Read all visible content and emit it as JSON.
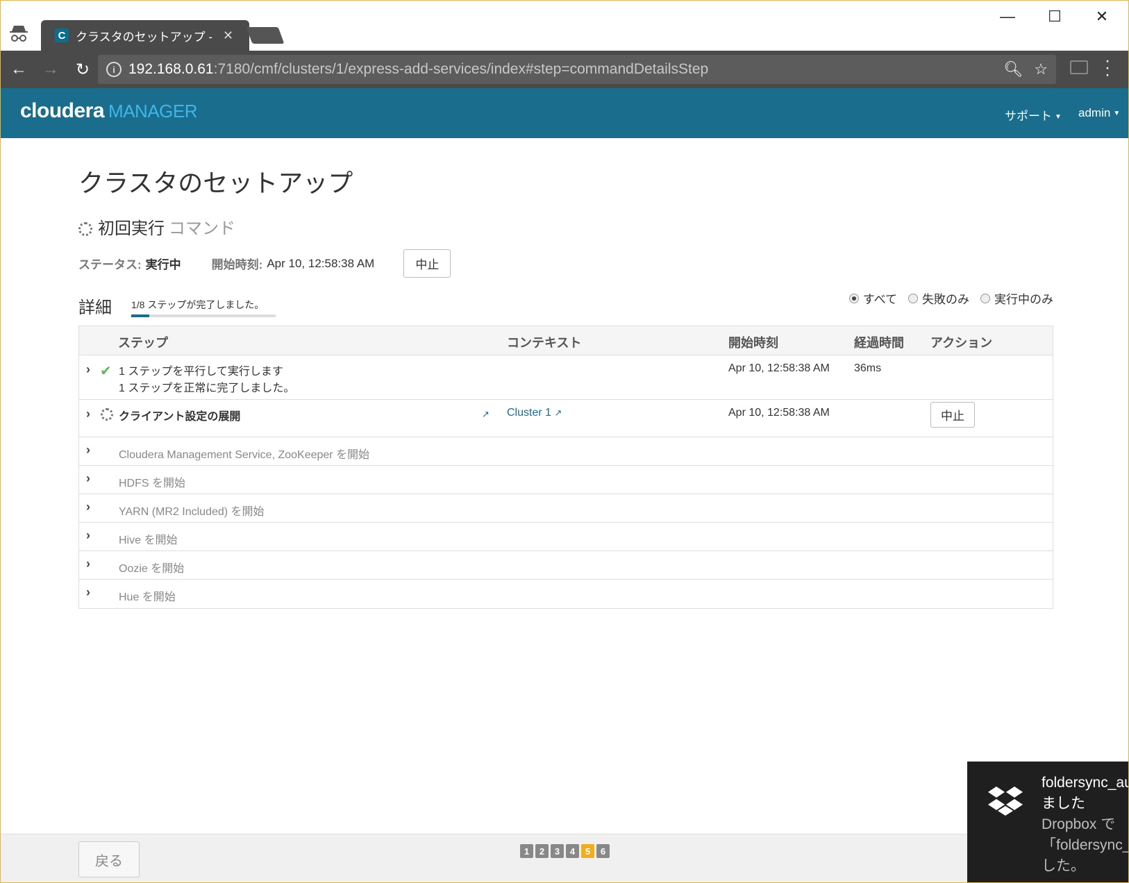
{
  "browser": {
    "tab_title": "クラスタのセットアップ - Clou",
    "url_host": "192.168.0.61",
    "url_rest": ":7180/cmf/clusters/1/express-add-services/index#step=commandDetailsStep"
  },
  "header": {
    "logo_main": "cloudera",
    "logo_sub": "MANAGER",
    "menu_support": "サポート",
    "menu_user": "admin"
  },
  "page": {
    "title": "クラスタのセットアップ",
    "subtitle_main": "初回実行",
    "subtitle_muted": "コマンド",
    "status_label": "ステータス:",
    "status_value": "実行中",
    "start_label": "開始時刻:",
    "start_value": "Apr 10, 12:58:38 AM",
    "abort_button": "中止",
    "details_title": "詳細",
    "progress_text": "1/8 ステップが完了しました。",
    "progress_fraction": 0.125,
    "filters": [
      "すべて",
      "失敗のみ",
      "実行中のみ"
    ]
  },
  "table": {
    "headers": {
      "step": "ステップ",
      "context": "コンテキスト",
      "start": "開始時刻",
      "elapsed": "経過時間",
      "action": "アクション"
    },
    "row1": {
      "title": "1 ステップを平行して実行します",
      "sub": "1 ステップを正常に完了しました。",
      "start": "Apr 10, 12:58:38 AM",
      "elapsed": "36ms"
    },
    "row2": {
      "title": "クライアント設定の展開",
      "context": "Cluster 1",
      "start": "Apr 10, 12:58:38 AM",
      "action": "中止"
    },
    "pending": [
      "Cloudera Management Service, ZooKeeper を開始",
      "HDFS を開始",
      "YARN (MR2 Included) を開始",
      "Hive を開始",
      "Oozie を開始",
      "Hue を開始"
    ]
  },
  "footer": {
    "back": "戻る",
    "steps": [
      "1",
      "2",
      "3",
      "4",
      "5",
      "6"
    ],
    "active_step": "5"
  },
  "toast": {
    "title_line1": "foldersync_au",
    "title_line2": "ました",
    "body_line1": "Dropbox で",
    "body_line2": "「foldersync_a",
    "body_line3": "した。"
  },
  "colors": {
    "header_bg": "#1b6d8e",
    "accent": "#3fb6e8",
    "active_step": "#f0ad1e",
    "success": "#5cb85c"
  }
}
